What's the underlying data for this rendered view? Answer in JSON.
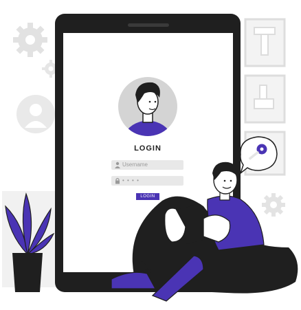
{
  "login": {
    "title": "LOGIN",
    "username_placeholder": "Username",
    "password_mask": "• • • •",
    "button_label": "LOGIN"
  },
  "colors": {
    "accent": "#4a34b4",
    "tablet": "#1f1f1f",
    "screen": "#ffffff",
    "field_bg": "#e8e8e8"
  },
  "icons": [
    "gear-icon",
    "user-avatar-icon",
    "key-icon",
    "lock-icon",
    "user-icon",
    "plant-icon"
  ]
}
